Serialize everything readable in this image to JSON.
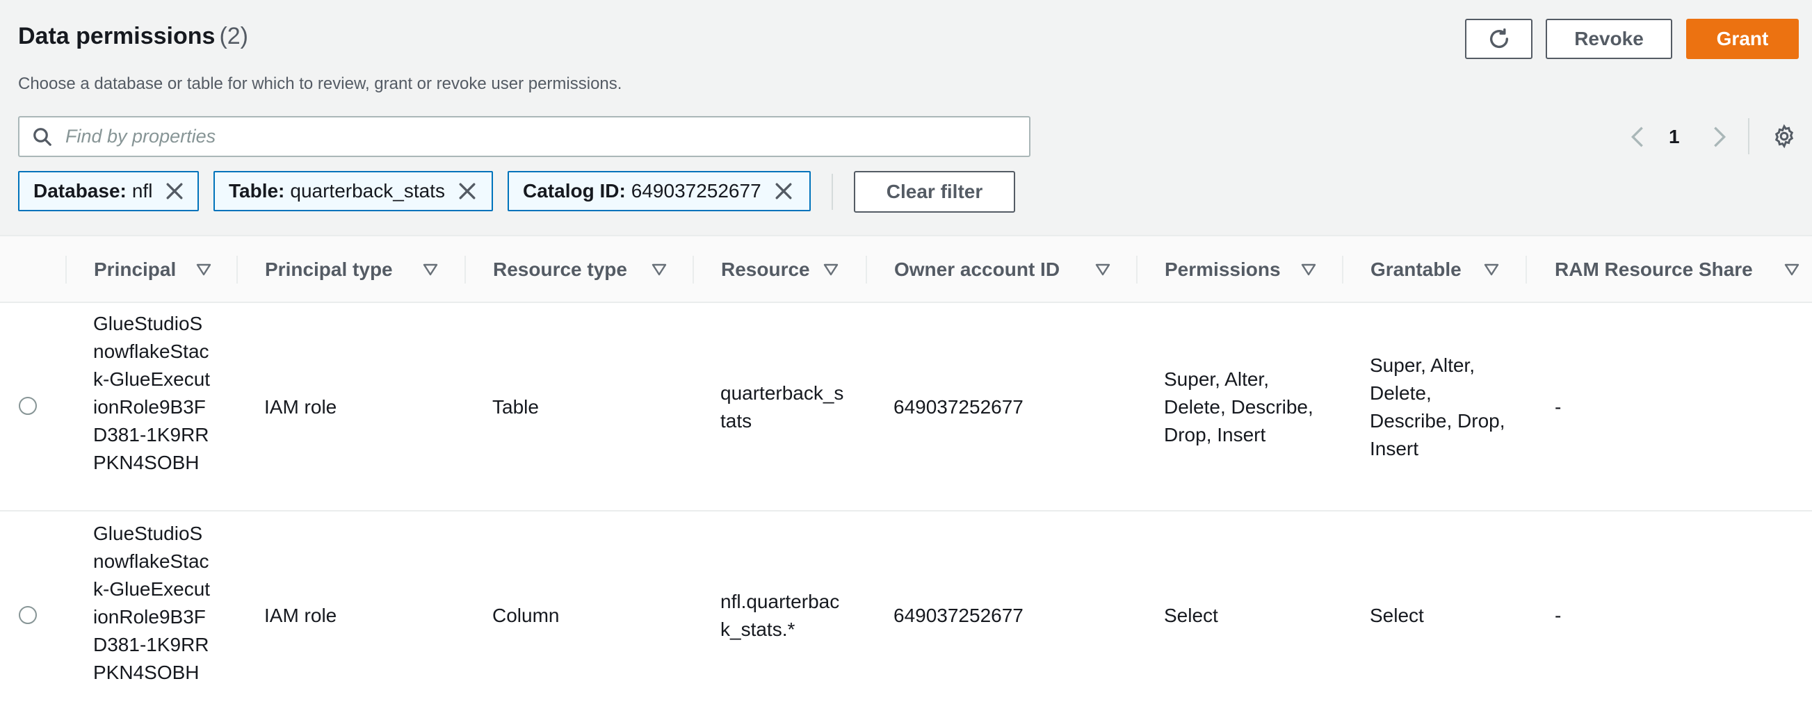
{
  "header": {
    "title": "Data permissions",
    "count": "(2)",
    "subtitle": "Choose a database or table for which to review, grant or revoke user permissions.",
    "buttons": {
      "revoke": "Revoke",
      "grant": "Grant"
    }
  },
  "search": {
    "placeholder": "Find by properties",
    "value": ""
  },
  "pagination": {
    "current_page": "1"
  },
  "filters": [
    {
      "key": "Database:",
      "value": "nfl"
    },
    {
      "key": "Table:",
      "value": "quarterback_stats"
    },
    {
      "key": "Catalog ID:",
      "value": "649037252677"
    }
  ],
  "clear_filter_label": "Clear filter",
  "table": {
    "columns": [
      "Principal",
      "Principal type",
      "Resource type",
      "Resource",
      "Owner account ID",
      "Permissions",
      "Grantable",
      "RAM Resource Share"
    ],
    "rows": [
      {
        "principal": "GlueStudioSnowflakeStack-GlueExecutionRole9B3FD381-1K9RRPKN4SOBH",
        "principal_type": "IAM role",
        "resource_type": "Table",
        "resource": "quarterback_stats",
        "owner_account_id": "649037252677",
        "permissions": "Super, Alter, Delete, Describe, Drop, Insert",
        "grantable": "Super, Alter, Delete, Describe, Drop, Insert",
        "ram_resource_share": "-"
      },
      {
        "principal": "GlueStudioSnowflakeStack-GlueExecutionRole9B3FD381-1K9RRPKN4SOBH",
        "principal_type": "IAM role",
        "resource_type": "Column",
        "resource": "nfl.quarterback_stats.*",
        "owner_account_id": "649037252677",
        "permissions": "Select",
        "grantable": "Select",
        "ram_resource_share": "-"
      }
    ]
  },
  "colors": {
    "accent": "#ec7211",
    "token_border": "#0073bb",
    "header_bg": "#f2f3f3"
  },
  "icons": [
    "refresh-icon",
    "search-icon",
    "chevron-left-icon",
    "chevron-right-icon",
    "gear-icon",
    "close-icon",
    "sort-icon"
  ]
}
